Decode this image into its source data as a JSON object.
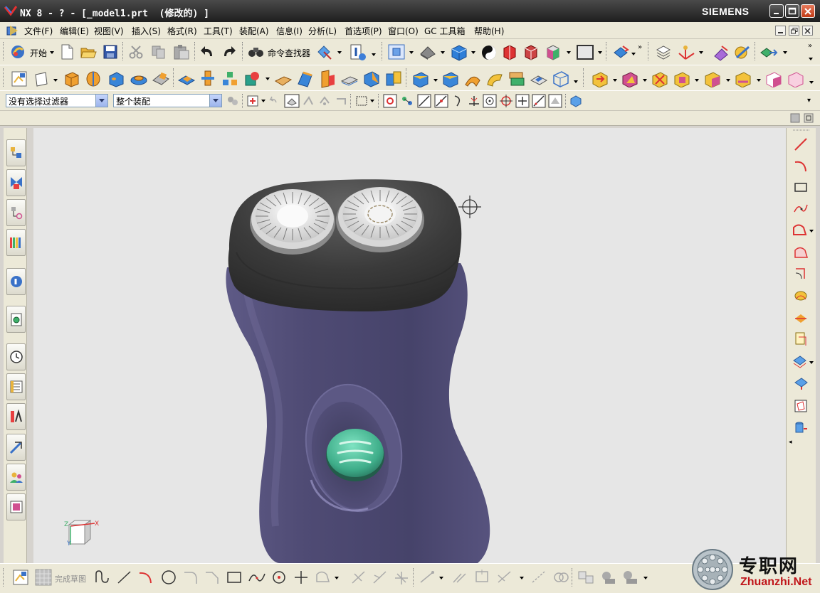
{
  "titlebar": {
    "title": "NX 8 - ? - [_model1.prt  (修改的) ]",
    "brand": "SIEMENS"
  },
  "menubar": {
    "items": [
      "文件(F)",
      "编辑(E)",
      "视图(V)",
      "插入(S)",
      "格式(R)",
      "工具(T)",
      "装配(A)",
      "信息(I)",
      "分析(L)",
      "首选项(P)",
      "窗口(O)",
      "GC 工具箱",
      "帮助(H)"
    ]
  },
  "toolbar_standard": {
    "start_label": "开始",
    "command_finder_label": "命令查找器"
  },
  "selection_bar": {
    "filter_value": "没有选择过滤器",
    "scope_value": "整个装配"
  },
  "sketch_toolbar": {
    "finish_sketch_label": "完成草图"
  },
  "triad": {
    "x_label": "X",
    "y_label": "Y",
    "z_label": "Z"
  },
  "watermark": {
    "cn": "专职网",
    "en": "Zhuanzhi.Net"
  },
  "colors": {
    "titlebar": "#2e2e2e",
    "chrome": "#ece9d8",
    "viewport": "#e6e6e6",
    "body_purple": "#4d4a6e",
    "head_gray": "#3c3c3c",
    "button_teal": "#4fc3a1"
  }
}
